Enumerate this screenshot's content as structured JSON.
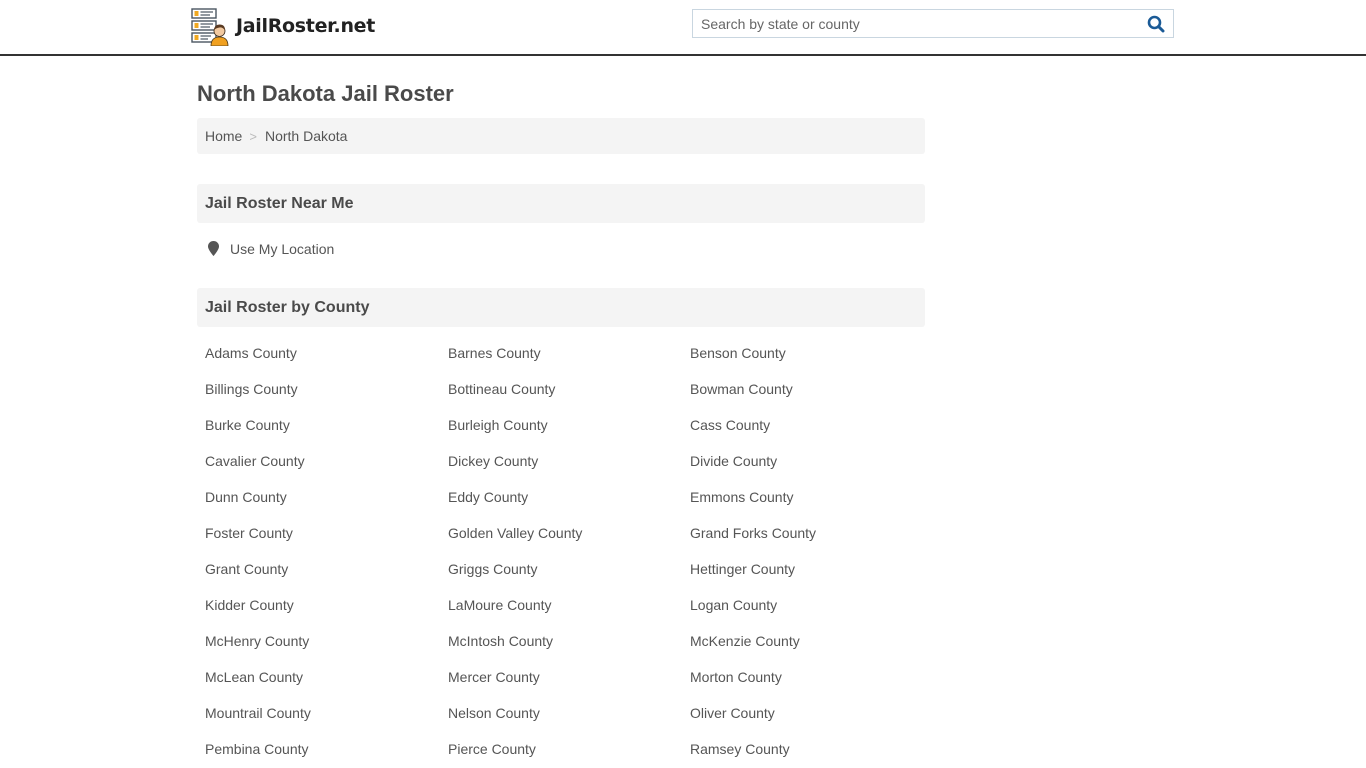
{
  "header": {
    "logo_text": "JailRoster.net",
    "search": {
      "placeholder": "Search by state or county",
      "value": ""
    },
    "search_icon": "search-icon",
    "accent_color": "#1a5a96"
  },
  "page": {
    "title": "North Dakota Jail Roster"
  },
  "breadcrumb": {
    "items": [
      {
        "label": "Home"
      },
      {
        "label": "North Dakota"
      }
    ],
    "separator": ">"
  },
  "near_me": {
    "heading": "Jail Roster Near Me",
    "location_label": "Use My Location",
    "icon": "map-pin-icon"
  },
  "by_county": {
    "heading": "Jail Roster by County",
    "counties": [
      "Adams County",
      "Barnes County",
      "Benson County",
      "Billings County",
      "Bottineau County",
      "Bowman County",
      "Burke County",
      "Burleigh County",
      "Cass County",
      "Cavalier County",
      "Dickey County",
      "Divide County",
      "Dunn County",
      "Eddy County",
      "Emmons County",
      "Foster County",
      "Golden Valley County",
      "Grand Forks County",
      "Grant County",
      "Griggs County",
      "Hettinger County",
      "Kidder County",
      "LaMoure County",
      "Logan County",
      "McHenry County",
      "McIntosh County",
      "McKenzie County",
      "McLean County",
      "Mercer County",
      "Morton County",
      "Mountrail County",
      "Nelson County",
      "Oliver County",
      "Pembina County",
      "Pierce County",
      "Ramsey County"
    ]
  }
}
